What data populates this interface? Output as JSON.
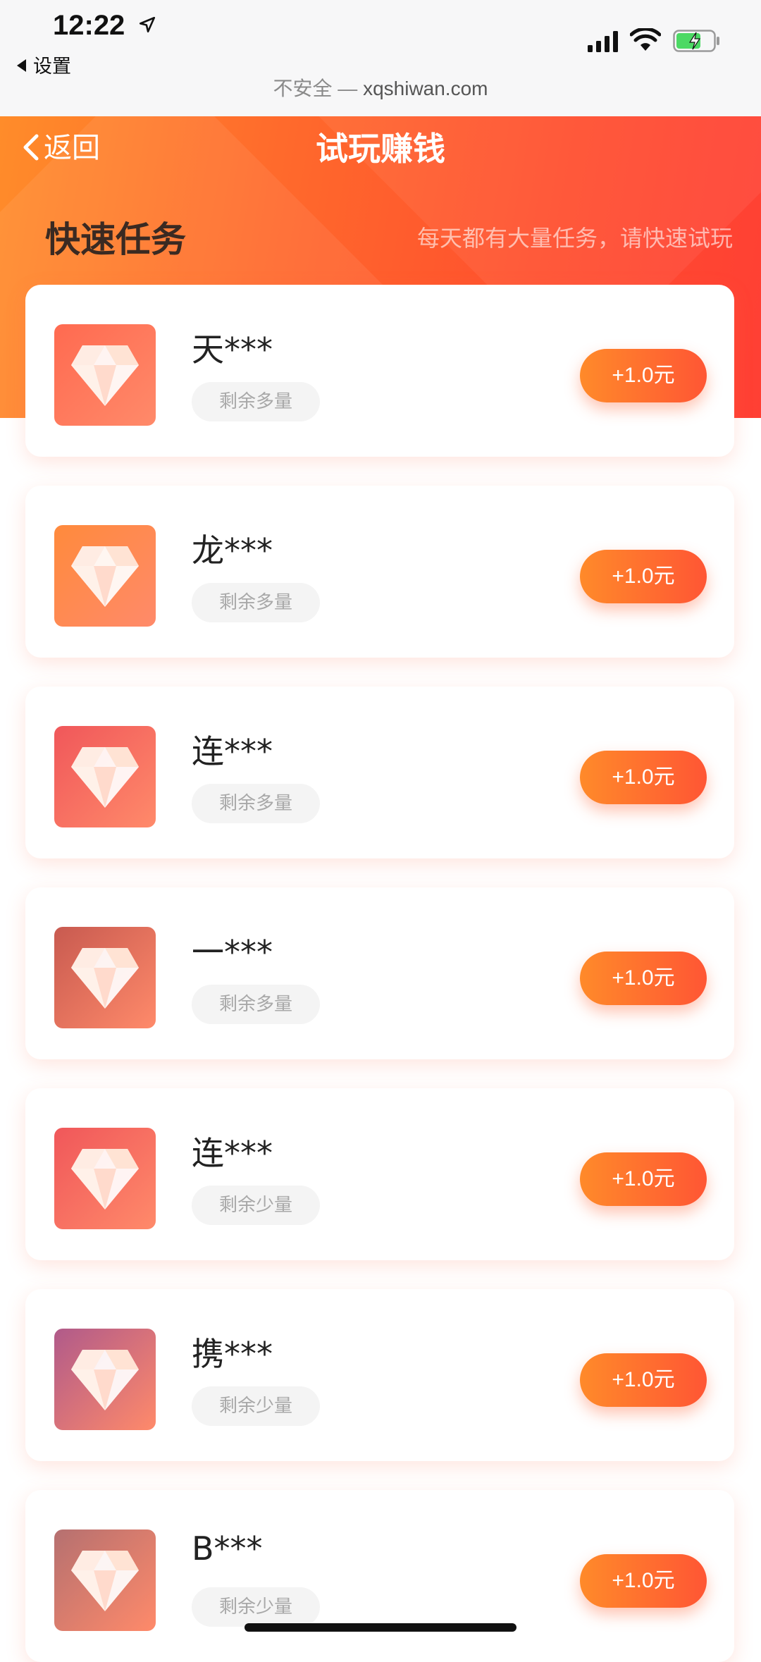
{
  "status_bar": {
    "time": "12:22",
    "back_app": "设置",
    "url_prefix": "不安全 —",
    "url": "xqshiwan.com"
  },
  "nav": {
    "back_label": "返回",
    "title": "试玩赚钱"
  },
  "section": {
    "title": "快速任务",
    "subtitle": "每天都有大量任务，请快速试玩"
  },
  "colors": {
    "accent": "#ff5a2e",
    "accent_light": "#ff8c2a"
  },
  "tasks": [
    {
      "name": "天***",
      "remaining": "剩余多量",
      "reward": "+1.0元",
      "icon_bg": "#ff6a50"
    },
    {
      "name": "龙***",
      "remaining": "剩余多量",
      "reward": "+1.0元",
      "icon_bg": "#ff8a3c"
    },
    {
      "name": "连***",
      "remaining": "剩余多量",
      "reward": "+1.0元",
      "icon_bg": "#f0575a"
    },
    {
      "name": "一***",
      "remaining": "剩余多量",
      "reward": "+1.0元",
      "icon_bg": "#c85a50"
    },
    {
      "name": "连***",
      "remaining": "剩余少量",
      "reward": "+1.0元",
      "icon_bg": "#f0575a"
    },
    {
      "name": "携***",
      "remaining": "剩余少量",
      "reward": "+1.0元",
      "icon_bg": "#b05a8a"
    },
    {
      "name": "B***",
      "remaining": "剩余少量",
      "reward": "+1.0元",
      "icon_bg": "#b57070"
    }
  ]
}
